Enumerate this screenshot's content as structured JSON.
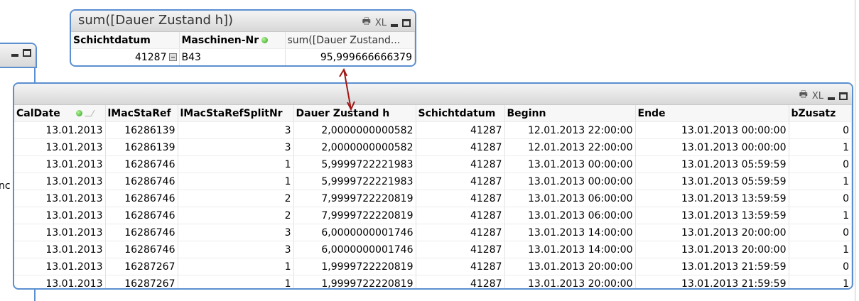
{
  "summary": {
    "title": "sum([Dauer Zustand h])",
    "print_icon": "printer-icon",
    "xl_label": "XL",
    "columns": [
      "Schichtdatum",
      "Maschinen-Nr",
      "sum([Dauer  Zustand..."
    ],
    "row": [
      "41287",
      "B43",
      "95,999666666379"
    ]
  },
  "left_fragment_text": "nc",
  "main": {
    "xl_label": "XL",
    "columns": [
      "CalDate",
      "lMacStaRef",
      "lMacStaRefSplitNr",
      "Dauer Zustand h",
      "Schichtdatum",
      "Beginn",
      "Ende",
      "bZusatz"
    ],
    "rows": [
      [
        "13.01.2013",
        "16286139",
        "3",
        "2,0000000000582",
        "41287",
        "12.01.2013 22:00:00",
        "13.01.2013 00:00:00",
        "0"
      ],
      [
        "13.01.2013",
        "16286139",
        "3",
        "2,0000000000582",
        "41287",
        "12.01.2013 22:00:00",
        "13.01.2013 00:00:00",
        "1"
      ],
      [
        "13.01.2013",
        "16286746",
        "1",
        "5,9999722221983",
        "41287",
        "13.01.2013 00:00:00",
        "13.01.2013 05:59:59",
        "0"
      ],
      [
        "13.01.2013",
        "16286746",
        "1",
        "5,9999722221983",
        "41287",
        "13.01.2013 00:00:00",
        "13.01.2013 05:59:59",
        "1"
      ],
      [
        "13.01.2013",
        "16286746",
        "2",
        "7,9999722220819",
        "41287",
        "13.01.2013 06:00:00",
        "13.01.2013 13:59:59",
        "0"
      ],
      [
        "13.01.2013",
        "16286746",
        "2",
        "7,9999722220819",
        "41287",
        "13.01.2013 06:00:00",
        "13.01.2013 13:59:59",
        "1"
      ],
      [
        "13.01.2013",
        "16286746",
        "3",
        "6,0000000001746",
        "41287",
        "13.01.2013 14:00:00",
        "13.01.2013 20:00:00",
        "0"
      ],
      [
        "13.01.2013",
        "16286746",
        "3",
        "6,0000000001746",
        "41287",
        "13.01.2013 14:00:00",
        "13.01.2013 20:00:00",
        "1"
      ],
      [
        "13.01.2013",
        "16287267",
        "1",
        "1,9999722220819",
        "41287",
        "13.01.2013 20:00:00",
        "13.01.2013 21:59:59",
        "0"
      ],
      [
        "13.01.2013",
        "16287267",
        "1",
        "1,9999722220819",
        "41287",
        "13.01.2013 20:00:00",
        "13.01.2013 21:59:59",
        "1"
      ]
    ]
  },
  "colors": {
    "border": "#5b8fd0",
    "arrow": "#a01818",
    "green_dot": "#2ca01c"
  }
}
